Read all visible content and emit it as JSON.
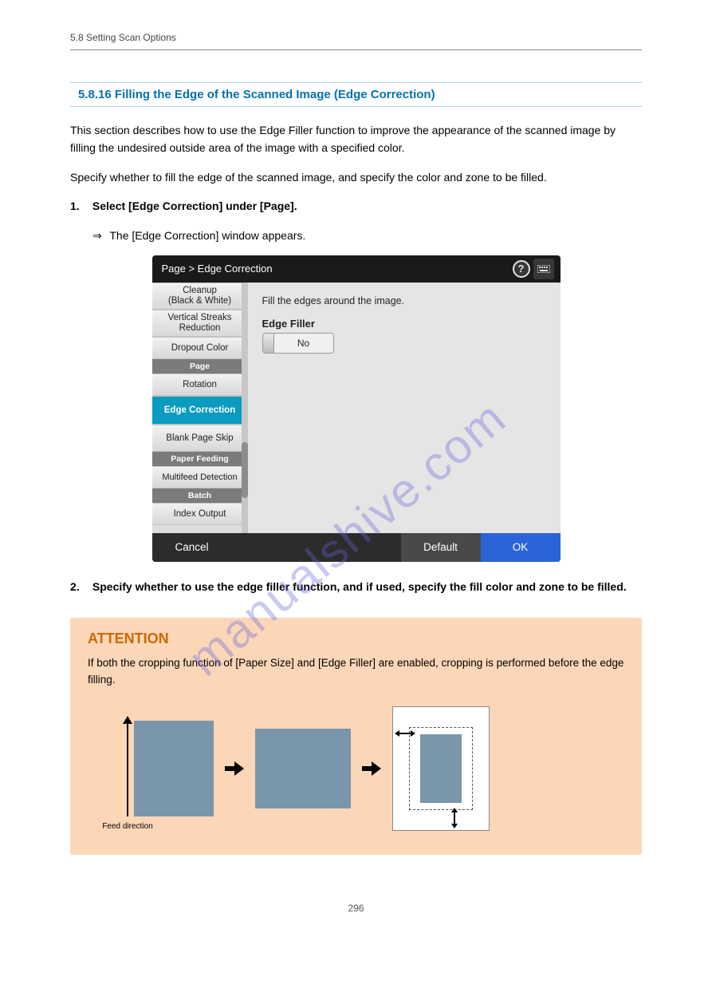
{
  "running_head": {
    "left": "5.8 Setting Scan Options",
    "right": ""
  },
  "section_title": "5.8.16 Filling the Edge of the Scanned Image (Edge Correction)",
  "intro": "This section describes how to use the Edge Filler function to improve the appearance of the scanned image by filling the undesired outside area of the image with a specified color.",
  "intro2": "Specify whether to fill the edge of the scanned image, and specify the color and zone to be filled.",
  "step": {
    "no": "1.",
    "text": "Select [Edge Correction] under [Page]."
  },
  "result_arrow": "⇒",
  "result_text": "The [Edge Correction] window appears.",
  "screen": {
    "breadcrumb": "Page  >  Edge Correction",
    "sidebar": {
      "item_cleanup1": "Cleanup",
      "item_cleanup2": "(Black & White)",
      "item_vsr1": "Vertical Streaks",
      "item_vsr2": "Reduction",
      "item_dropout": "Dropout Color",
      "cat_page": "Page",
      "item_rotation": "Rotation",
      "item_edge": "Edge Correction",
      "item_blank": "Blank Page Skip",
      "cat_paper": "Paper Feeding",
      "item_multifeed": "Multifeed Detection",
      "cat_batch": "Batch",
      "item_index": "Index Output"
    },
    "panel": {
      "desc": "Fill the edges around the image.",
      "label": "Edge Filler",
      "toggle_value": "No"
    },
    "footer": {
      "cancel": "Cancel",
      "default": "Default",
      "ok": "OK"
    }
  },
  "step2": {
    "no": "2.",
    "text": "Specify whether to use the edge filler function, and if used, specify the fill color and zone to be filled."
  },
  "attention": {
    "title": "ATTENTION",
    "body": "If both the cropping function of [Paper Size] and [Edge Filler] are enabled, cropping is performed before the edge filling.",
    "feed_caption": "Feed direction"
  },
  "watermark": "manualshive.com",
  "page_no": "296"
}
